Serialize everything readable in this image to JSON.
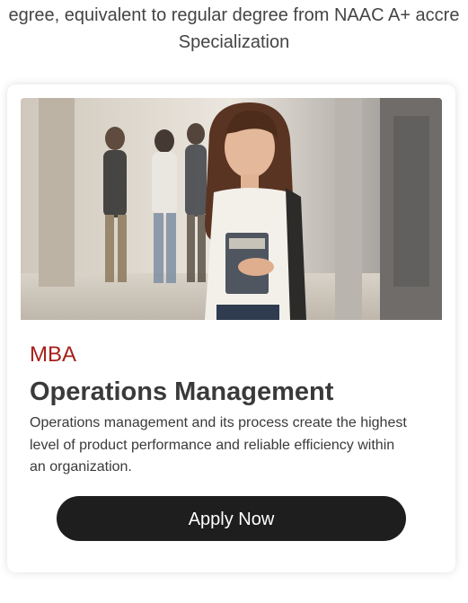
{
  "intro": {
    "line1": "egree, equivalent to regular degree from NAAC A+ accre",
    "line2": "Specialization"
  },
  "card": {
    "program": "MBA",
    "title": "Operations Management",
    "description": "Operations management and its process create the highest level of product performance and reliable efficiency within an organization.",
    "apply_label": "Apply Now"
  },
  "colors": {
    "program_accent": "#a8201a",
    "button_bg": "#1e1e1e",
    "button_text": "#ffffff"
  }
}
